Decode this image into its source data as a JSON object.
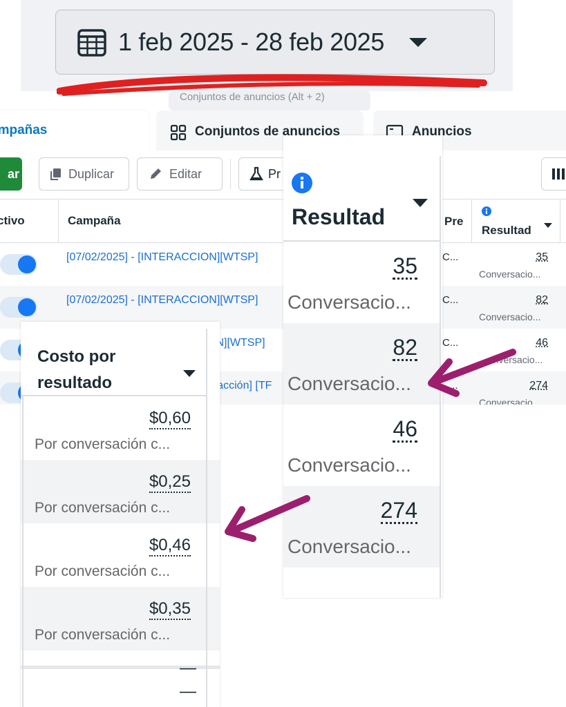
{
  "date_picker": {
    "range": "1 feb 2025 - 28 feb 2025"
  },
  "tooltip": {
    "text": "Conjuntos de anuncios (Alt + 2)"
  },
  "tabs": [
    {
      "label": "ampañas"
    },
    {
      "label": "Conjuntos de anuncios"
    },
    {
      "label": "Anuncios"
    }
  ],
  "toolbar": {
    "create_label": "ar",
    "duplicate_label": "Duplicar",
    "edit_label": "Editar",
    "pr_label": "Pr"
  },
  "table": {
    "headers": {
      "active": "ctivo",
      "campaign": "Campaña",
      "pre": "Pre",
      "result": "Resultad"
    },
    "rows": [
      {
        "campaign": "[07/02/2025] - [INTERACCION][WTSP]",
        "pre": "C...",
        "result": "35",
        "result_sub": "Conversacio..."
      },
      {
        "campaign": "[07/02/2025] - [INTERACCION][WTSP]",
        "pre": "C...",
        "result": "82",
        "result_sub": "Conversacio..."
      },
      {
        "campaign": "ON][WTSP]",
        "pre": "C...",
        "result": "46",
        "result_sub": "onversacio..."
      },
      {
        "campaign": "eracción] [TF",
        "pre": "...",
        "result": "274",
        "result_sub": "Conversacio..."
      }
    ]
  },
  "zoom_result": {
    "title": "Resultad",
    "rows": [
      {
        "value": "35",
        "sub": "Conversacio..."
      },
      {
        "value": "82",
        "sub": "Conversacio..."
      },
      {
        "value": "46",
        "sub": "Conversacio..."
      },
      {
        "value": "274",
        "sub": "Conversacio..."
      }
    ]
  },
  "zoom_cost": {
    "title_line1": "Costo por",
    "title_line2": "resultado",
    "rows": [
      {
        "value": "$0,60",
        "sub": "Por conversación c..."
      },
      {
        "value": "$0,25",
        "sub": "Por conversación c..."
      },
      {
        "value": "$0,46",
        "sub": "Por conversación c..."
      },
      {
        "value": "$0,35",
        "sub": "Por conversación c..."
      }
    ],
    "empty_1": "—",
    "empty_2": "—"
  },
  "colors": {
    "brand_blue": "#1877f2",
    "link_blue": "#1a6ed8",
    "create_green": "#1e8a3a",
    "annotation_red": "#e02020",
    "arrow_purple": "#9c1f6e"
  }
}
